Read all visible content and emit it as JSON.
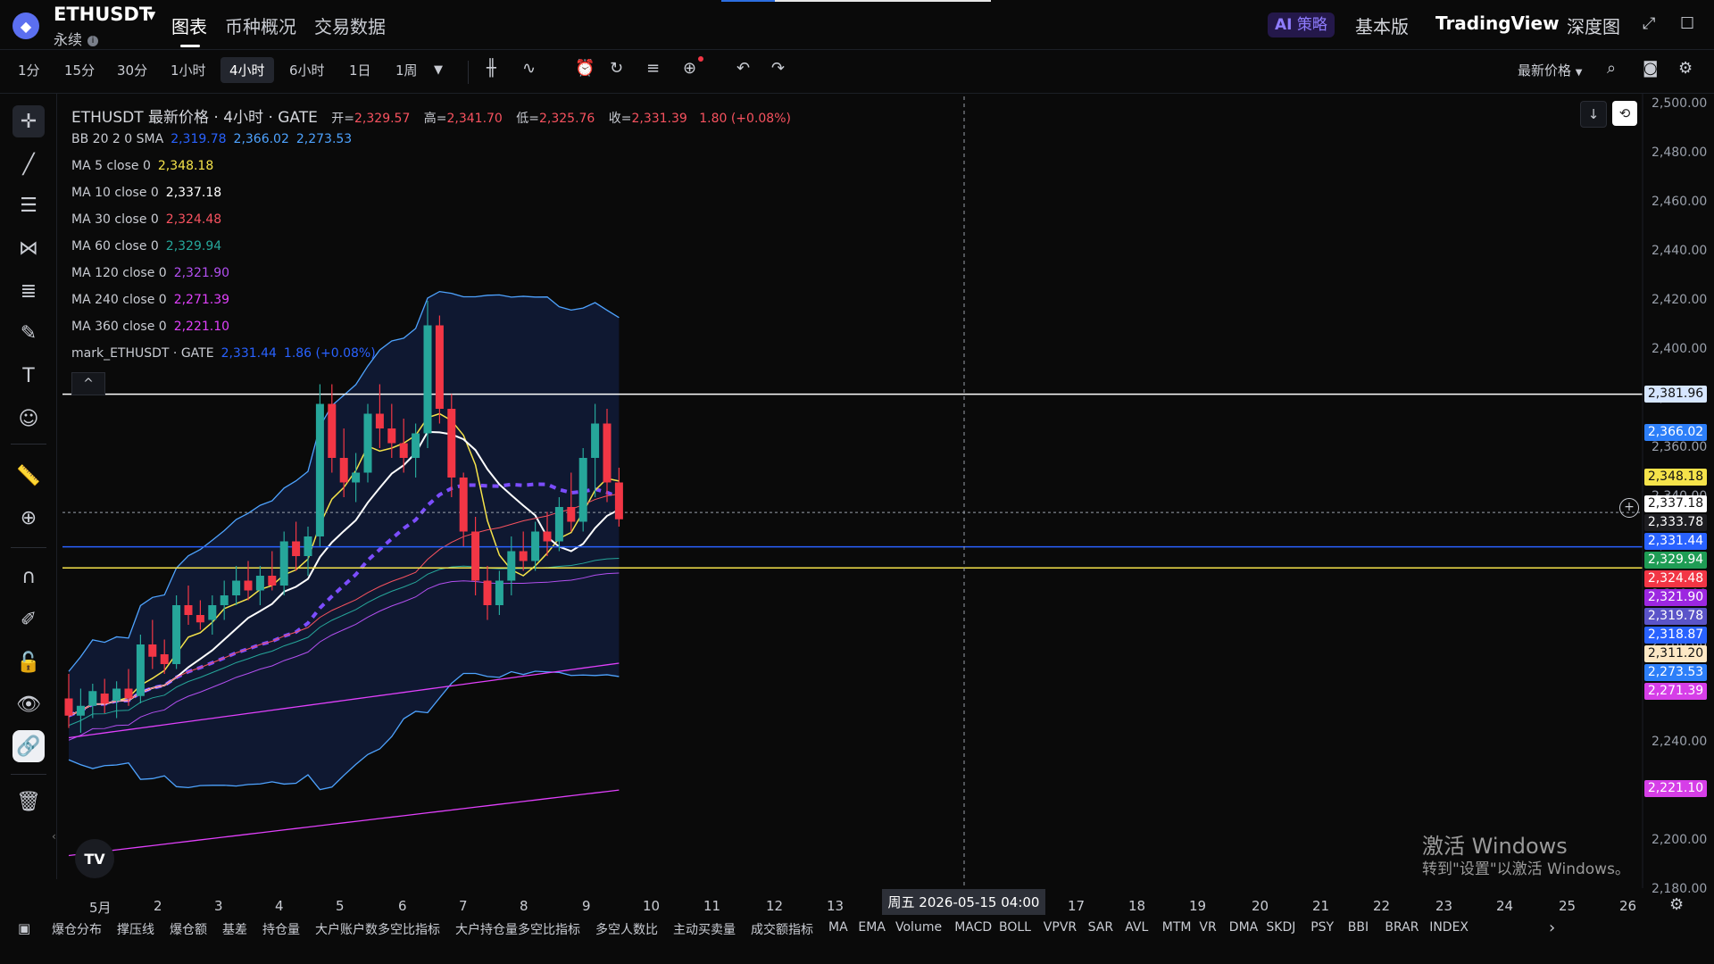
{
  "header": {
    "coin_icon": "ethereum-icon",
    "symbol": "ETHUSDT",
    "contract_type": "永续",
    "nav_tabs": [
      "图表",
      "币种概况",
      "交易数据"
    ],
    "ai_button": "策略",
    "ai_prefix": "AI",
    "right_links": [
      "基本版",
      "TradingView",
      "深度图"
    ]
  },
  "toolbar": {
    "timeframes": [
      "1分",
      "15分",
      "30分",
      "1小时",
      "4小时",
      "6小时",
      "1日",
      "1周"
    ],
    "active_timeframe": "4小时",
    "price_type": "最新价格"
  },
  "legend": {
    "title": "ETHUSDT 最新价格 · 4小时 · GATE",
    "open_label": "开=",
    "open": "2,329.57",
    "high_label": "高=",
    "high": "2,341.70",
    "low_label": "低=",
    "low": "2,325.76",
    "close_label": "收=",
    "close": "2,331.39",
    "change": "1.80 (+0.08%)",
    "indicators": [
      {
        "label": "BB 20 2 0 SMA",
        "values": [
          "2,319.78",
          "2,366.02",
          "2,273.53"
        ],
        "colors": [
          "#2962ff",
          "#4ea3ff",
          "#4ea3ff"
        ]
      },
      {
        "label": "MA 5 close 0",
        "values": [
          "2,348.18"
        ],
        "colors": [
          "#f5e34a"
        ]
      },
      {
        "label": "MA 10 close 0",
        "values": [
          "2,337.18"
        ],
        "colors": [
          "#ffffff"
        ]
      },
      {
        "label": "MA 30 close 0",
        "values": [
          "2,324.48"
        ],
        "colors": [
          "#f7525f"
        ]
      },
      {
        "label": "MA 60 close 0",
        "values": [
          "2,329.94"
        ],
        "colors": [
          "#26a69a"
        ]
      },
      {
        "label": "MA 120 close 0",
        "values": [
          "2,321.90"
        ],
        "colors": [
          "#b24ff0"
        ]
      },
      {
        "label": "MA 240 close 0",
        "values": [
          "2,271.39"
        ],
        "colors": [
          "#e040fb"
        ]
      },
      {
        "label": "MA 360 close 0",
        "values": [
          "2,221.10"
        ],
        "colors": [
          "#e040fb"
        ]
      },
      {
        "label": "mark_ETHUSDT · GATE",
        "values": [
          "2,331.44",
          "1.86 (+0.08%)"
        ],
        "colors": [
          "#2962ff",
          "#2962ff"
        ]
      }
    ]
  },
  "y_axis": {
    "ticks": [
      "2,500.00",
      "2,480.00",
      "2,460.00",
      "2,440.00",
      "2,420.00",
      "2,400.00",
      "2,380.00",
      "2,360.00",
      "2,340.00",
      "2,320.00",
      "2,300.00",
      "2,280.00",
      "2,260.00",
      "2,240.00",
      "2,220.00",
      "2,200.00",
      "2,180.00"
    ],
    "price_tags": [
      {
        "value": "2,381.96",
        "bg": "#d6e6ff",
        "fg": "#111111"
      },
      {
        "value": "2,366.02",
        "bg": "#2d7ff9",
        "fg": "#ffffff"
      },
      {
        "value": "2,348.18",
        "bg": "#f5e34a",
        "fg": "#111111"
      },
      {
        "value": "2,337.18",
        "bg": "#ffffff",
        "fg": "#111111"
      },
      {
        "value": "2,331.44",
        "bg": "#2962ff",
        "fg": "#ffffff"
      },
      {
        "value": "2,333.78",
        "bg": "#1e1e22",
        "fg": "#ffffff"
      },
      {
        "value": "2,329.94",
        "bg": "#1f9d55",
        "fg": "#ffffff"
      },
      {
        "value": "2,324.48",
        "bg": "#f23645",
        "fg": "#ffffff"
      },
      {
        "value": "2,321.90",
        "bg": "#9c27e0",
        "fg": "#ffffff"
      },
      {
        "value": "2,319.78",
        "bg": "#5b54c8",
        "fg": "#ffffff"
      },
      {
        "value": "2,318.87",
        "bg": "#2962ff",
        "fg": "#ffffff"
      },
      {
        "value": "2,311.20",
        "bg": "#fde8c5",
        "fg": "#111111"
      },
      {
        "value": "2,273.53",
        "bg": "#2d7ff9",
        "fg": "#ffffff"
      },
      {
        "value": "2,271.39",
        "bg": "#d63ee8",
        "fg": "#ffffff"
      },
      {
        "value": "2,221.10",
        "bg": "#d63ee8",
        "fg": "#ffffff"
      }
    ]
  },
  "x_axis": {
    "ticks": [
      "5月",
      "2",
      "3",
      "4",
      "5",
      "6",
      "7",
      "8",
      "9",
      "10",
      "11",
      "12",
      "13",
      "17",
      "18",
      "19",
      "20",
      "21",
      "22",
      "23",
      "24",
      "25",
      "26"
    ],
    "crosshair_label": "周五 2026-05-15   04:00"
  },
  "indicator_tabs": [
    "爆仓分布",
    "撑压线",
    "爆仓额",
    "基差",
    "持仓量",
    "大户账户数多空比指标",
    "大户持仓量多空比指标",
    "多空人数比",
    "主动买卖量",
    "成交额指标",
    "MA",
    "EMA",
    "Volume",
    "MACD",
    "BOLL",
    "VPVR",
    "SAR",
    "AVL",
    "MTM",
    "VR",
    "DMA",
    "SKDJ",
    "PSY",
    "BBI",
    "BRAR",
    "INDEX"
  ],
  "watermark": {
    "line1": "激活 Windows",
    "line2": "转到\"设置\"以激活 Windows。"
  },
  "tv_logo": "TV",
  "chart_data": {
    "type": "candlestick",
    "symbol": "ETHUSDT",
    "interval": "4小时",
    "y_range": [
      2180,
      2500
    ],
    "candles_ohlc": [
      [
        2258,
        2268,
        2246,
        2251
      ],
      [
        2251,
        2262,
        2244,
        2255
      ],
      [
        2255,
        2264,
        2250,
        2261
      ],
      [
        2260,
        2266,
        2252,
        2256
      ],
      [
        2257,
        2265,
        2250,
        2262
      ],
      [
        2262,
        2270,
        2255,
        2258
      ],
      [
        2259,
        2284,
        2256,
        2280
      ],
      [
        2280,
        2290,
        2270,
        2275
      ],
      [
        2276,
        2282,
        2268,
        2272
      ],
      [
        2272,
        2300,
        2270,
        2296
      ],
      [
        2296,
        2304,
        2288,
        2292
      ],
      [
        2292,
        2298,
        2286,
        2289
      ],
      [
        2290,
        2300,
        2284,
        2296
      ],
      [
        2296,
        2306,
        2290,
        2300
      ],
      [
        2300,
        2312,
        2296,
        2306
      ],
      [
        2306,
        2314,
        2298,
        2302
      ],
      [
        2302,
        2312,
        2296,
        2308
      ],
      [
        2308,
        2318,
        2302,
        2304
      ],
      [
        2304,
        2326,
        2300,
        2322
      ],
      [
        2322,
        2330,
        2310,
        2316
      ],
      [
        2316,
        2328,
        2308,
        2324
      ],
      [
        2324,
        2386,
        2320,
        2378
      ],
      [
        2378,
        2386,
        2350,
        2356
      ],
      [
        2356,
        2368,
        2340,
        2346
      ],
      [
        2346,
        2358,
        2338,
        2350
      ],
      [
        2350,
        2378,
        2346,
        2374
      ],
      [
        2374,
        2386,
        2360,
        2368
      ],
      [
        2368,
        2378,
        2356,
        2362
      ],
      [
        2362,
        2372,
        2350,
        2356
      ],
      [
        2356,
        2370,
        2348,
        2366
      ],
      [
        2366,
        2420,
        2360,
        2410
      ],
      [
        2410,
        2414,
        2370,
        2376
      ],
      [
        2376,
        2382,
        2340,
        2348
      ],
      [
        2348,
        2350,
        2320,
        2326
      ],
      [
        2326,
        2332,
        2300,
        2306
      ],
      [
        2306,
        2312,
        2290,
        2296
      ],
      [
        2296,
        2310,
        2292,
        2306
      ],
      [
        2306,
        2324,
        2300,
        2318
      ],
      [
        2318,
        2326,
        2310,
        2314
      ],
      [
        2314,
        2330,
        2310,
        2326
      ],
      [
        2326,
        2334,
        2316,
        2322
      ],
      [
        2322,
        2340,
        2318,
        2336
      ],
      [
        2336,
        2350,
        2326,
        2330
      ],
      [
        2330,
        2360,
        2326,
        2356
      ],
      [
        2356,
        2378,
        2340,
        2370
      ],
      [
        2370,
        2376,
        2338,
        2346
      ],
      [
        2346,
        2352,
        2328,
        2331
      ]
    ],
    "horizontal_lines": [
      2381.96,
      2333.78,
      2319.78,
      2311.2
    ],
    "last_price": "2,333.78"
  }
}
